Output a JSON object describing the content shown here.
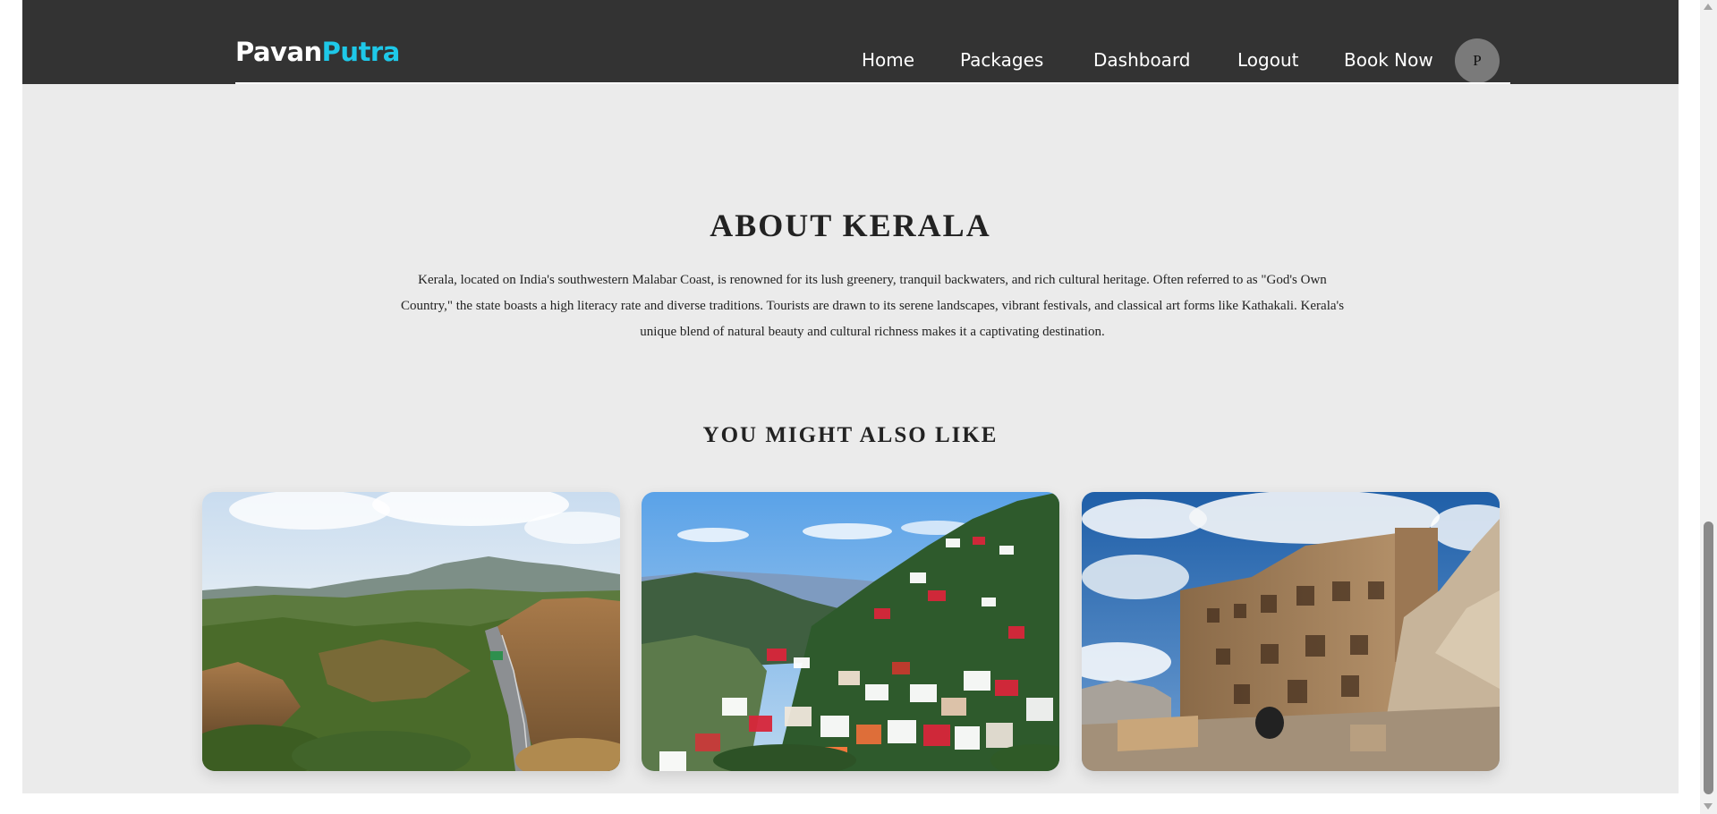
{
  "brand": {
    "part1": "Pavan",
    "part2": "Putra"
  },
  "nav": {
    "home": "Home",
    "packages": "Packages",
    "dashboard": "Dashboard",
    "logout": "Logout",
    "book_now": "Book Now"
  },
  "avatar": {
    "initial": "P"
  },
  "about": {
    "title": "ABOUT KERALA",
    "text": "Kerala, located on India's southwestern Malabar Coast, is renowned for its lush greenery, tranquil backwaters, and rich cultural heritage. Often referred to as \"God's Own Country,\" the state boasts a high literacy rate and diverse traditions. Tourists are drawn to its serene landscapes, vibrant festivals, and classical art forms like Kathakali. Kerala's unique blend of natural beauty and cultural richness makes it a captivating destination."
  },
  "recommendations": {
    "title": "YOU MIGHT ALSO LIKE"
  },
  "colors": {
    "navbar_bg": "#333333",
    "brand_accent": "#1ec8e8",
    "page_bg": "#ebebeb",
    "avatar_bg": "#7a7a7a"
  }
}
